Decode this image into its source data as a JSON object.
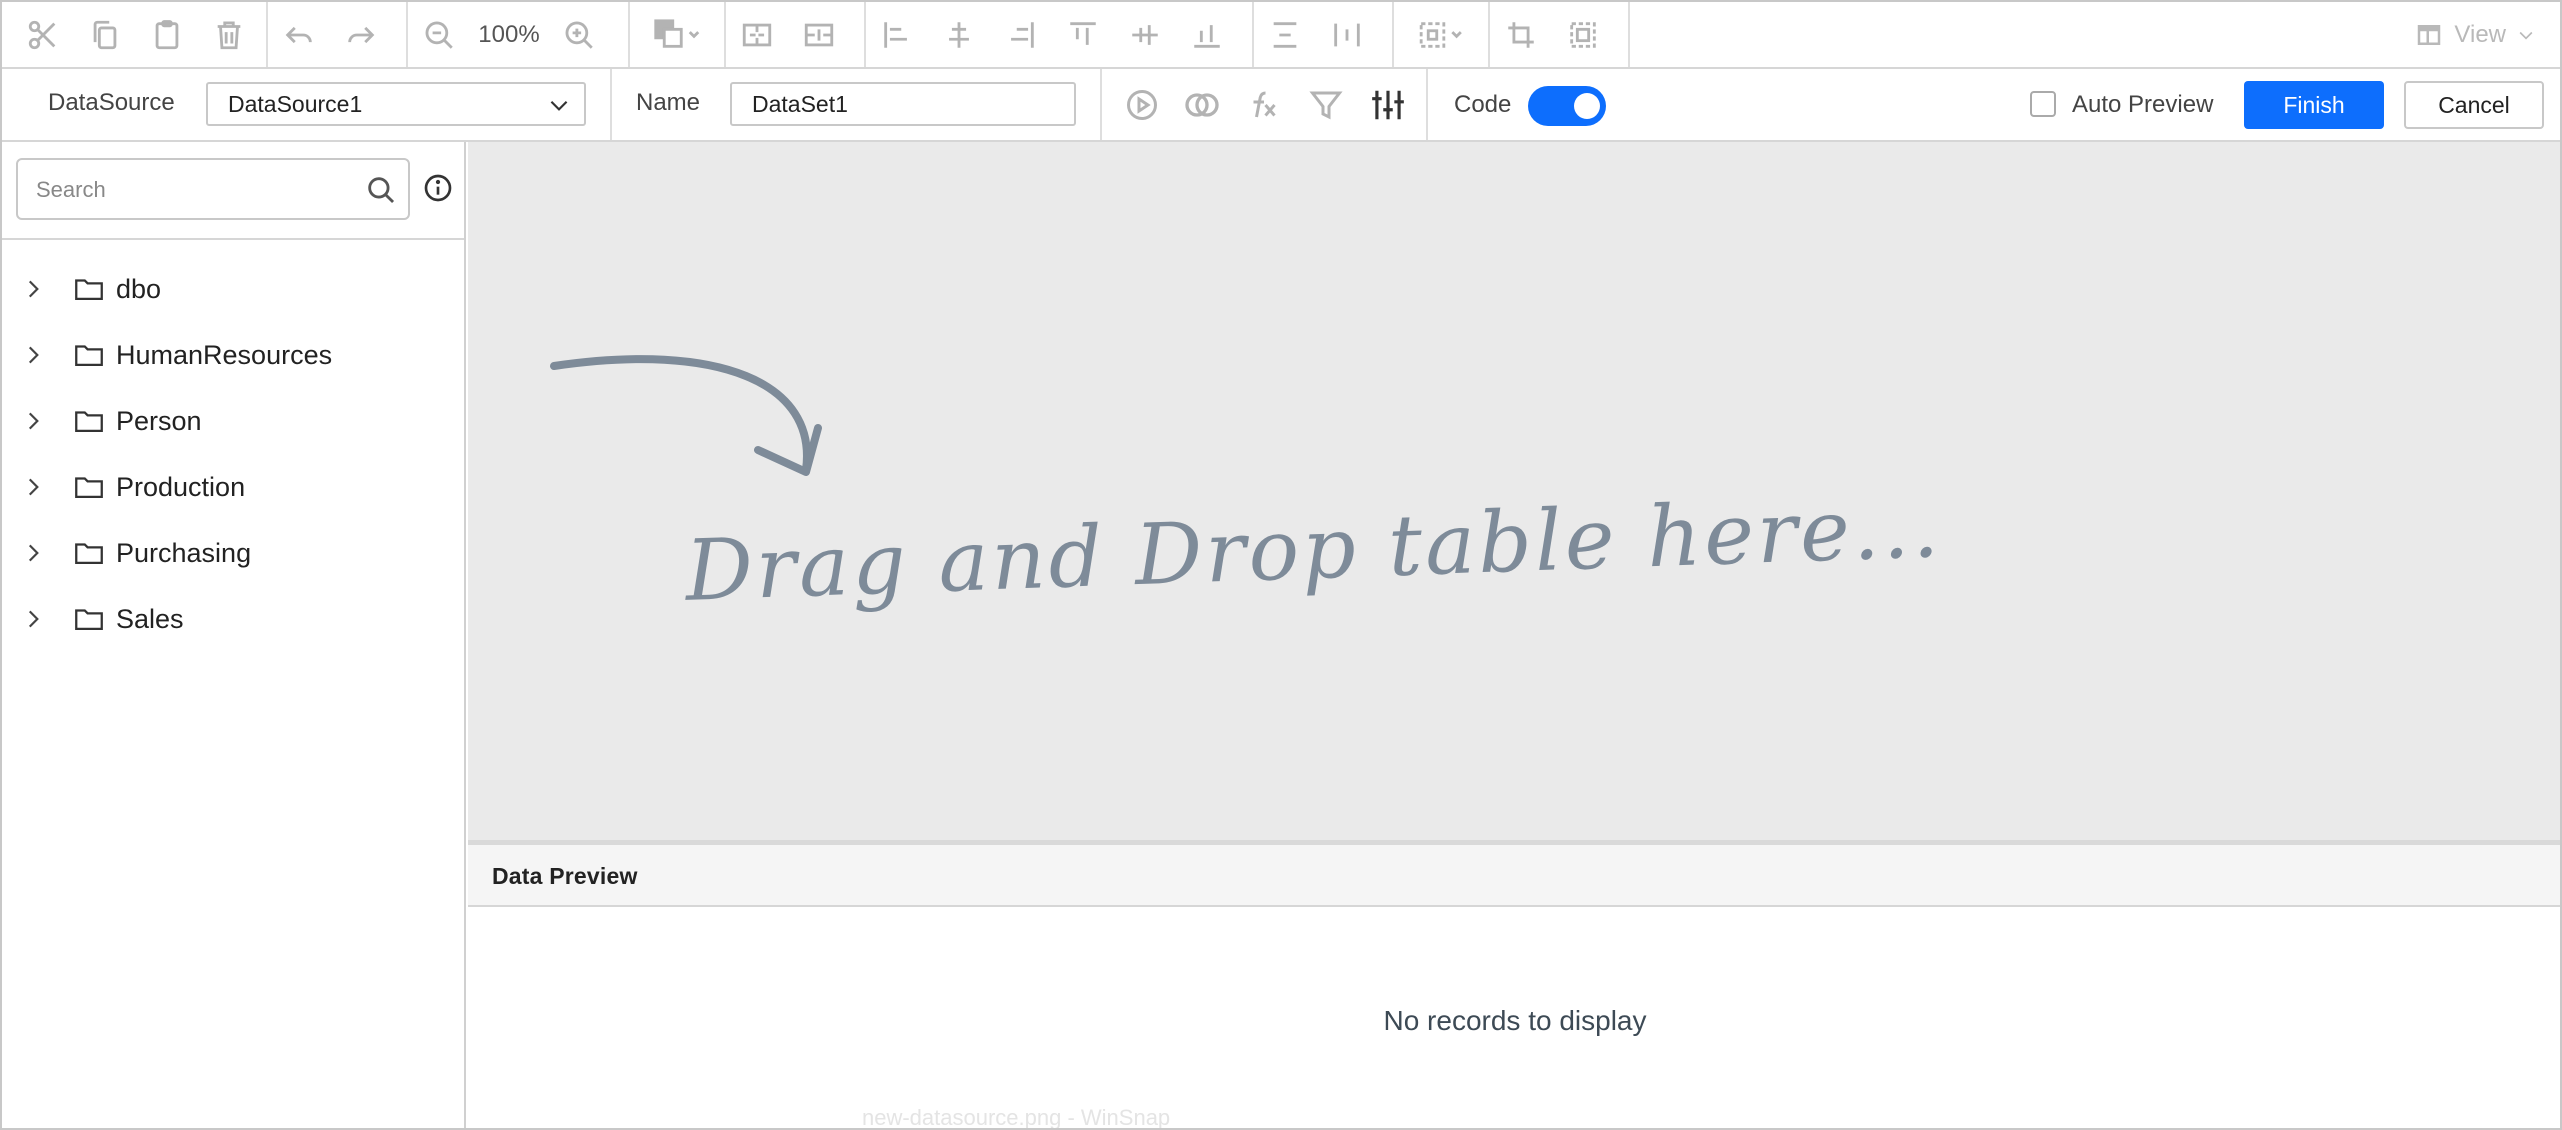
{
  "toolbar": {
    "zoom_level": "100%",
    "view_label": "View"
  },
  "properties": {
    "datasource_label": "DataSource",
    "datasource_value": "DataSource1",
    "name_label": "Name",
    "name_value": "DataSet1",
    "code_label": "Code",
    "code_enabled": true,
    "auto_preview_label": "Auto Preview",
    "auto_preview_checked": false,
    "finish_label": "Finish",
    "cancel_label": "Cancel"
  },
  "sidebar": {
    "search_placeholder": "Search",
    "items": [
      {
        "label": "dbo"
      },
      {
        "label": "HumanResources"
      },
      {
        "label": "Person"
      },
      {
        "label": "Production"
      },
      {
        "label": "Purchasing"
      },
      {
        "label": "Sales"
      }
    ]
  },
  "canvas": {
    "drop_hint": "Drag and Drop table here..."
  },
  "preview": {
    "title": "Data Preview",
    "empty_message": "No records to display"
  },
  "footer": {
    "ghost_text": "new-datasource.png - WinSnap"
  },
  "colors": {
    "accent": "#0d6efd",
    "canvas_bg": "#eaeaea",
    "icon_gray": "#b3b3b3",
    "hint_color": "#7e8b99"
  }
}
